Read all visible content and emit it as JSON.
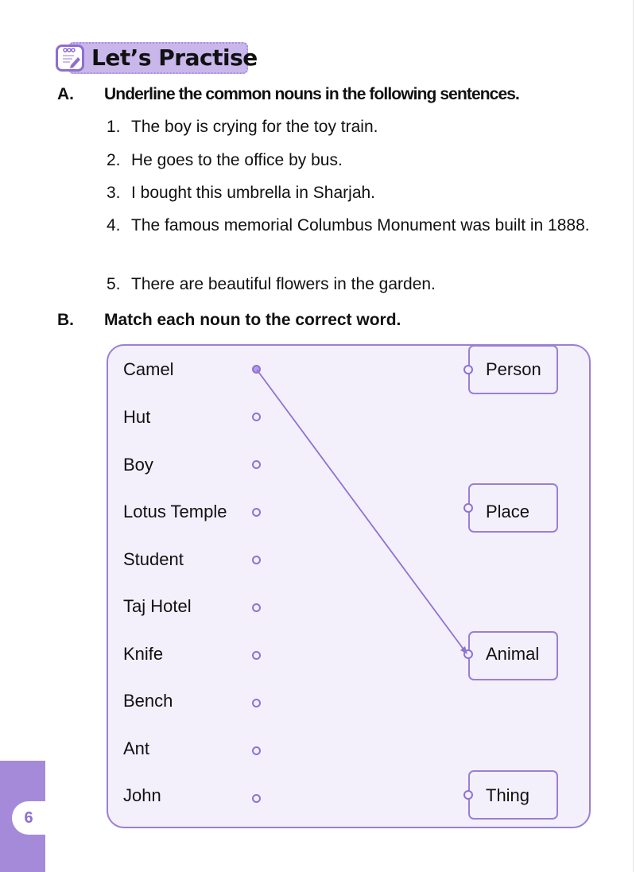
{
  "header": {
    "title": "Let’s Practise",
    "icon": "notepad-pencil-icon"
  },
  "section_a": {
    "letter": "A.",
    "instruction": "Underline the common nouns in the following sentences.",
    "items": [
      {
        "num": "1.",
        "text": "The boy is crying for the toy train."
      },
      {
        "num": "2.",
        "text": "He goes to the office by bus."
      },
      {
        "num": "3.",
        "text": "I bought this umbrella in Sharjah."
      },
      {
        "num": "4.",
        "text": "The famous memorial Columbus Monument was built in 1888."
      },
      {
        "num": "5.",
        "text": "There are beautiful flowers in the garden."
      }
    ]
  },
  "section_b": {
    "letter": "B.",
    "instruction": "Match each noun to the correct word.",
    "nouns": [
      "Camel",
      "Hut",
      "Boy",
      "Lotus Temple",
      "Student",
      "Taj Hotel",
      "Knife",
      "Bench",
      "Ant",
      "John"
    ],
    "categories": [
      "Person",
      "Place",
      "Animal",
      "Thing"
    ],
    "example_match": {
      "noun": "Camel",
      "category": "Animal"
    }
  },
  "colors": {
    "accent": "#9b7fd4",
    "box_fill": "#f3f0fc",
    "banner_fill": "#c9b7ec",
    "page_tab": "#a58ad9"
  },
  "footer": {
    "page_number": "6"
  }
}
